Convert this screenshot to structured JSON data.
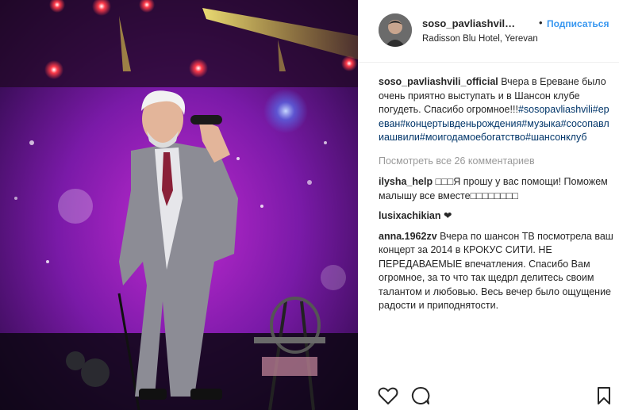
{
  "post": {
    "username": "soso_pavliashvili_official",
    "username_short": "soso_pavliashvili_of...",
    "follow_dot": "•",
    "follow_label": "Подписаться",
    "location": "Radisson Blu Hotel, Yerevan"
  },
  "caption": {
    "user": "soso_pavliashvili_official",
    "text": "Вчера в Ереване было очень приятно выступать и в Шансон клубе погудеть. Спасибо огромное!!!",
    "hashtags": "#sosopavliashvili#ереван#концертывденьрождения#музыка#сосопавлиашвили#моигодамоебогатство#шансонклуб"
  },
  "view_all": "Посмотреть все 26 комментариев",
  "comments": [
    {
      "user": "ilysha_help",
      "text": "□□□Я прошу у вас помощи! Поможем малышу все вместе□□□□□□□□"
    },
    {
      "user": "lusixachikian",
      "text": "❤"
    },
    {
      "user": "anna.1962zv",
      "text": "Вчера по шансон ТВ посмотрела ваш концерт за 2014 в КРОКУС СИТИ. НЕ ПЕРЕДАВАЕМЫЕ впечатления. Спасибо Вам огромное, за то что так щедрл делитесь своим талантом и любовью. Весь вечер было ощущение радости и приподнятости."
    }
  ],
  "actions": {
    "like_icon": "heart-outline-icon",
    "comment_icon": "comment-bubble-icon",
    "save_icon": "bookmark-outline-icon"
  },
  "colors": {
    "follow": "#3897f0",
    "hashtag": "#003569",
    "muted": "#999999",
    "stage_purple": "#8a1fb0",
    "spotlight_yellow": "#f4e04a"
  }
}
